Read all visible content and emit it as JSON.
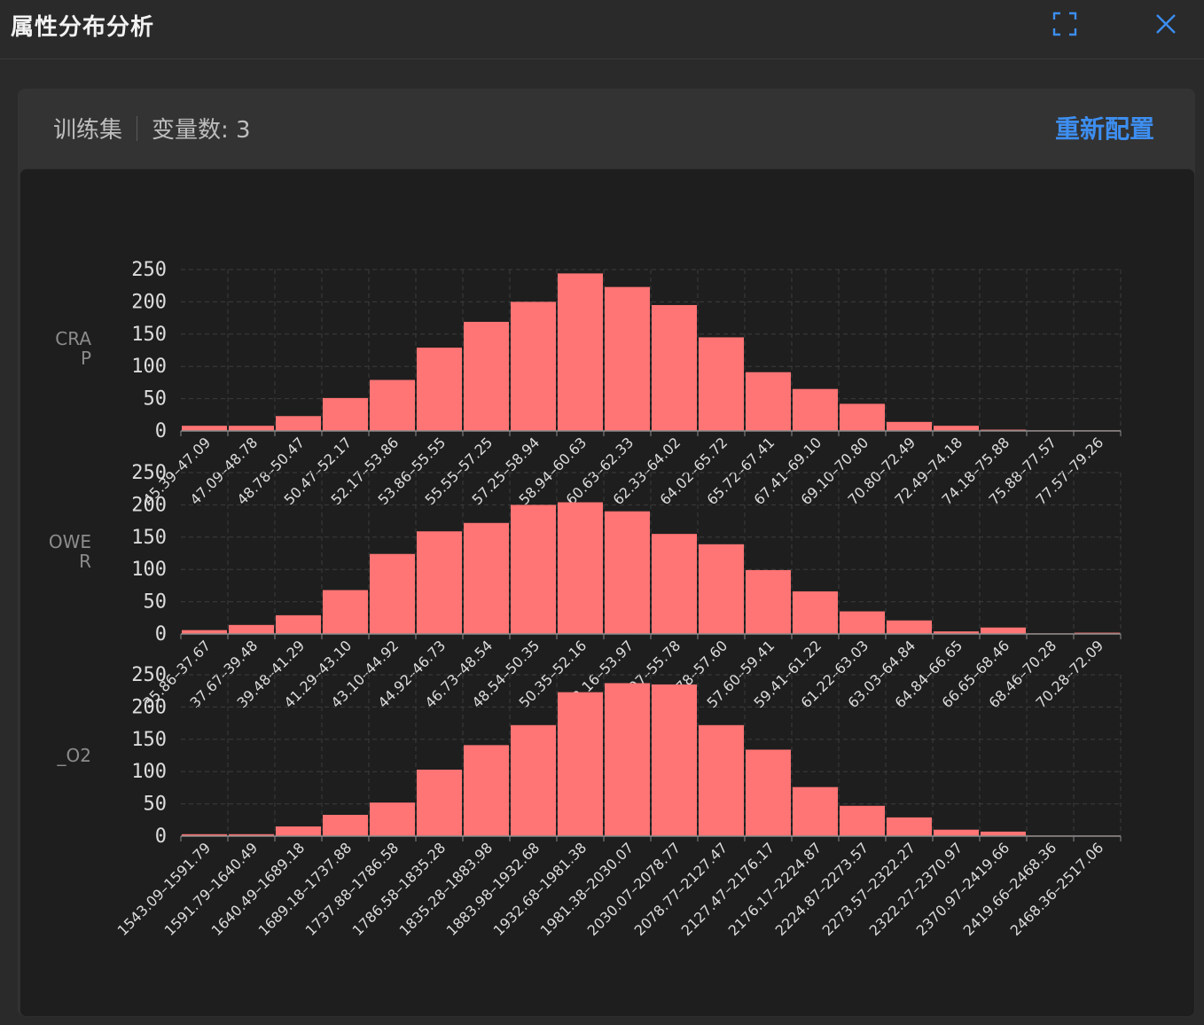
{
  "window": {
    "title": "属性分布分析"
  },
  "header": {
    "dataset_label": "训练集",
    "var_count_label": "变量数: 3",
    "reconfig_label": "重新配置"
  },
  "colors": {
    "bar": "#ff7474",
    "accent": "#3d8ef0",
    "background": "#1e1e1e"
  },
  "variable_labels": [
    {
      "line1": "CRA",
      "line2": "P"
    },
    {
      "line1": "OWE",
      "line2": "R"
    },
    {
      "line1": "_O2",
      "line2": ""
    }
  ],
  "chart_data": [
    {
      "type": "bar",
      "title": "",
      "series_label": "CRAP",
      "ylim": [
        0,
        250
      ],
      "yticks": [
        0,
        50,
        100,
        150,
        200,
        250
      ],
      "grid": true,
      "categories": [
        "45.39–47.09",
        "47.09–48.78",
        "48.78–50.47",
        "50.47–52.17",
        "52.17–53.86",
        "53.86–55.55",
        "55.55–57.25",
        "57.25–58.94",
        "58.94–60.63",
        "60.63–62.33",
        "62.33–64.02",
        "64.02–65.72",
        "65.72–67.41",
        "67.41–69.10",
        "69.10–70.80",
        "70.80–72.49",
        "72.49–74.18",
        "74.18–75.88",
        "75.88–77.57",
        "77.57–79.26"
      ],
      "values": [
        8,
        8,
        23,
        51,
        79,
        129,
        169,
        200,
        244,
        223,
        195,
        145,
        91,
        65,
        42,
        14,
        8,
        2,
        1,
        1
      ]
    },
    {
      "type": "bar",
      "title": "",
      "series_label": "OWER",
      "ylim": [
        0,
        250
      ],
      "yticks": [
        0,
        50,
        100,
        150,
        200,
        250
      ],
      "grid": true,
      "categories": [
        "35.86–37.67",
        "37.67–39.48",
        "39.48–41.29",
        "41.29–43.10",
        "43.10–44.92",
        "44.92–46.73",
        "46.73–48.54",
        "48.54–50.35",
        "50.35–52.16",
        "52.16–53.97",
        "53.97–55.78",
        "55.78–57.60",
        "57.60–59.41",
        "59.41–61.22",
        "61.22–63.03",
        "63.03–64.84",
        "64.84–66.65",
        "66.65–68.46",
        "68.46–70.28",
        "70.28–72.09"
      ],
      "values": [
        6,
        14,
        29,
        68,
        124,
        159,
        172,
        200,
        204,
        190,
        155,
        139,
        99,
        66,
        35,
        21,
        4,
        10,
        1,
        2
      ]
    },
    {
      "type": "bar",
      "title": "",
      "series_label": "_O2",
      "ylim": [
        0,
        250
      ],
      "yticks": [
        0,
        50,
        100,
        150,
        200,
        250
      ],
      "grid": true,
      "categories": [
        "1543.09–1591.79",
        "1591.79–1640.49",
        "1640.49–1689.18",
        "1689.18–1737.88",
        "1737.88–1786.58",
        "1786.58–1835.28",
        "1835.28–1883.98",
        "1883.98–1932.68",
        "1932.68–1981.38",
        "1981.38–2030.07",
        "2030.07–2078.77",
        "2078.77–2127.47",
        "2127.47–2176.17",
        "2176.17–2224.87",
        "2224.87–2273.57",
        "2273.57–2322.27",
        "2322.27–2370.97",
        "2370.97–2419.66",
        "2419.66–2468.36",
        "2468.36–2517.06"
      ],
      "values": [
        3,
        3,
        15,
        33,
        52,
        103,
        141,
        172,
        223,
        237,
        235,
        172,
        134,
        76,
        47,
        29,
        10,
        7,
        1,
        1
      ]
    }
  ]
}
